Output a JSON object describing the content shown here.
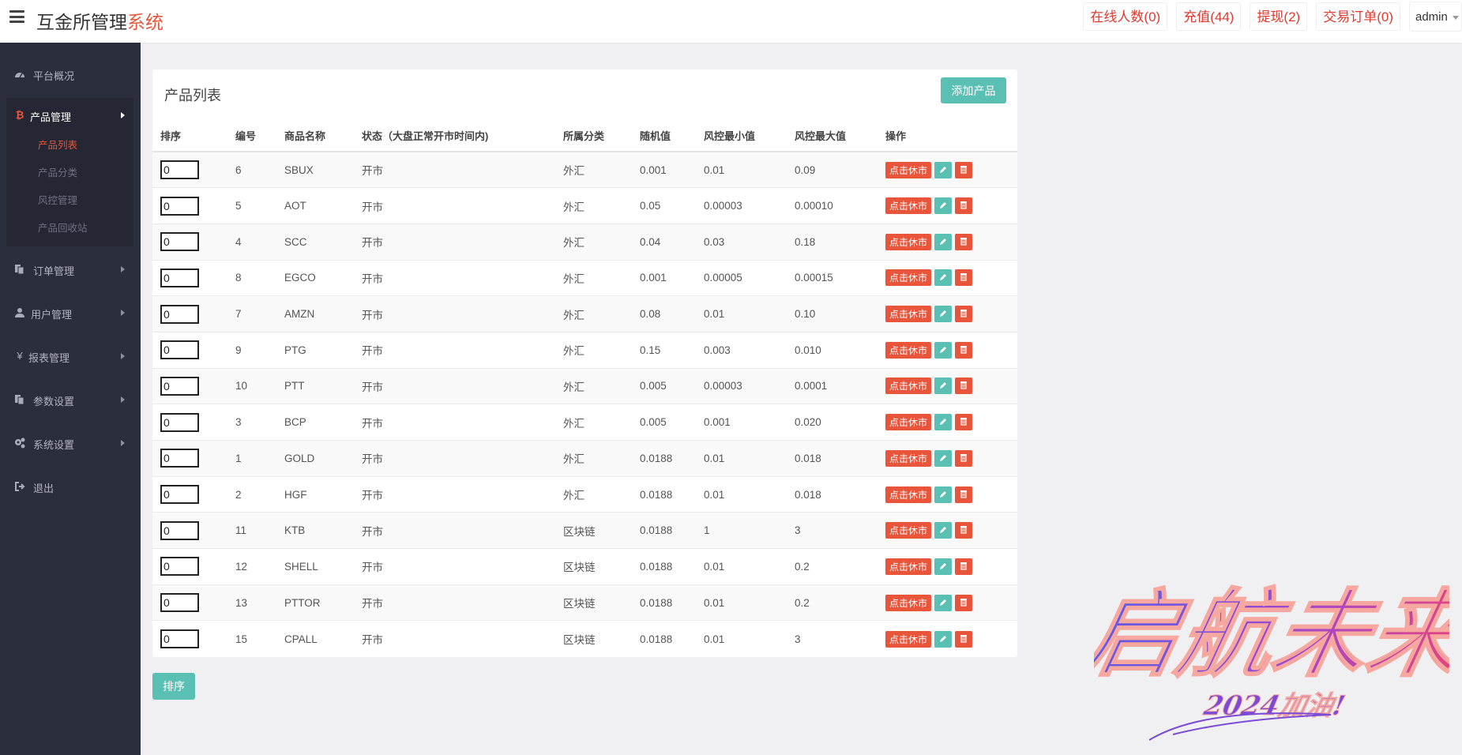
{
  "header": {
    "brand_main": "互金所管理",
    "brand_accent": "系统",
    "online": "在线人数(0)",
    "recharge": "充值(44)",
    "withdraw": "提现(2)",
    "orders": "交易订单(0)",
    "user": "admin"
  },
  "sidebar": {
    "overview": "平台概况",
    "product_mgmt": "产品管理",
    "sub": [
      "产品列表",
      "产品分类",
      "风控管理",
      "产品回收站"
    ],
    "order_mgmt": "订单管理",
    "user_mgmt": "用户管理",
    "report_mgmt": "报表管理",
    "param_settings": "参数设置",
    "system_settings": "系统设置",
    "logout": "退出"
  },
  "panel": {
    "title": "产品列表",
    "add_button": "添加产品",
    "sort_button": "排序",
    "columns": [
      "排序",
      "编号",
      "商品名称",
      "状态（大盘正常开市时间内)",
      "所属分类",
      "随机值",
      "风控最小值",
      "风控最大值",
      "操作"
    ],
    "close_market_label": "点击休市",
    "rows": [
      {
        "sort": "0",
        "id": "6",
        "name": "SBUX",
        "status": "开市",
        "category": "外汇",
        "random": "0.001",
        "min": "0.01",
        "max": "0.09"
      },
      {
        "sort": "0",
        "id": "5",
        "name": "AOT",
        "status": "开市",
        "category": "外汇",
        "random": "0.05",
        "min": "0.00003",
        "max": "0.00010"
      },
      {
        "sort": "0",
        "id": "4",
        "name": "SCC",
        "status": "开市",
        "category": "外汇",
        "random": "0.04",
        "min": "0.03",
        "max": "0.18"
      },
      {
        "sort": "0",
        "id": "8",
        "name": "EGCO",
        "status": "开市",
        "category": "外汇",
        "random": "0.001",
        "min": "0.00005",
        "max": "0.00015"
      },
      {
        "sort": "0",
        "id": "7",
        "name": "AMZN",
        "status": "开市",
        "category": "外汇",
        "random": "0.08",
        "min": "0.01",
        "max": "0.10"
      },
      {
        "sort": "0",
        "id": "9",
        "name": "PTG",
        "status": "开市",
        "category": "外汇",
        "random": "0.15",
        "min": "0.003",
        "max": "0.010"
      },
      {
        "sort": "0",
        "id": "10",
        "name": "PTT",
        "status": "开市",
        "category": "外汇",
        "random": "0.005",
        "min": "0.00003",
        "max": "0.0001"
      },
      {
        "sort": "0",
        "id": "3",
        "name": "BCP",
        "status": "开市",
        "category": "外汇",
        "random": "0.005",
        "min": "0.001",
        "max": "0.020"
      },
      {
        "sort": "0",
        "id": "1",
        "name": "GOLD",
        "status": "开市",
        "category": "外汇",
        "random": "0.0188",
        "min": "0.01",
        "max": "0.018"
      },
      {
        "sort": "0",
        "id": "2",
        "name": "HGF",
        "status": "开市",
        "category": "外汇",
        "random": "0.0188",
        "min": "0.01",
        "max": "0.018"
      },
      {
        "sort": "0",
        "id": "11",
        "name": "KTB",
        "status": "开市",
        "category": "区块链",
        "random": "0.0188",
        "min": "1",
        "max": "3"
      },
      {
        "sort": "0",
        "id": "12",
        "name": "SHELL",
        "status": "开市",
        "category": "区块链",
        "random": "0.0188",
        "min": "0.01",
        "max": "0.2"
      },
      {
        "sort": "0",
        "id": "13",
        "name": "PTTOR",
        "status": "开市",
        "category": "区块链",
        "random": "0.0188",
        "min": "0.01",
        "max": "0.2"
      },
      {
        "sort": "0",
        "id": "15",
        "name": "CPALL",
        "status": "开市",
        "category": "区块链",
        "random": "0.0188",
        "min": "0.01",
        "max": "3"
      }
    ]
  },
  "watermark": {
    "main": "启航未来",
    "sub": "2024加油!"
  },
  "colors": {
    "accent_red": "#e8553a",
    "teal": "#5bc0b4",
    "sidebar_bg": "#2b2e3c"
  }
}
